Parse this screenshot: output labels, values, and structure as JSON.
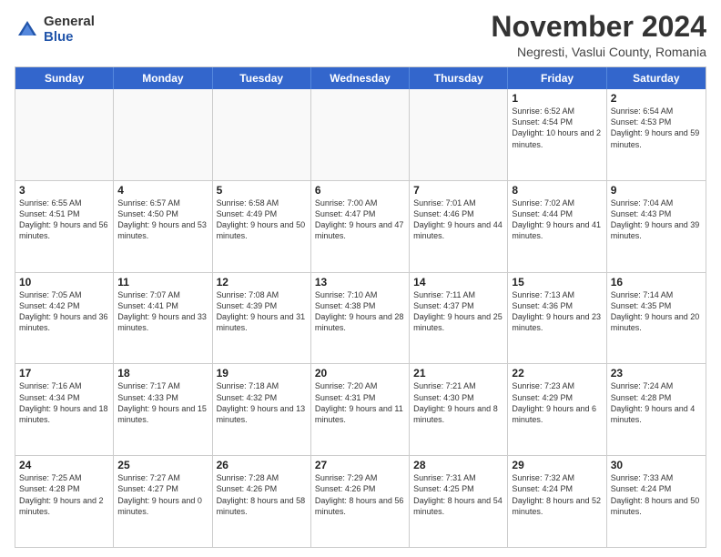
{
  "logo": {
    "general": "General",
    "blue": "Blue"
  },
  "title": "November 2024",
  "location": "Negresti, Vaslui County, Romania",
  "days": [
    "Sunday",
    "Monday",
    "Tuesday",
    "Wednesday",
    "Thursday",
    "Friday",
    "Saturday"
  ],
  "rows": [
    [
      {
        "day": "",
        "text": "",
        "empty": true
      },
      {
        "day": "",
        "text": "",
        "empty": true
      },
      {
        "day": "",
        "text": "",
        "empty": true
      },
      {
        "day": "",
        "text": "",
        "empty": true
      },
      {
        "day": "",
        "text": "",
        "empty": true
      },
      {
        "day": "1",
        "text": "Sunrise: 6:52 AM\nSunset: 4:54 PM\nDaylight: 10 hours\nand 2 minutes."
      },
      {
        "day": "2",
        "text": "Sunrise: 6:54 AM\nSunset: 4:53 PM\nDaylight: 9 hours\nand 59 minutes."
      }
    ],
    [
      {
        "day": "3",
        "text": "Sunrise: 6:55 AM\nSunset: 4:51 PM\nDaylight: 9 hours\nand 56 minutes."
      },
      {
        "day": "4",
        "text": "Sunrise: 6:57 AM\nSunset: 4:50 PM\nDaylight: 9 hours\nand 53 minutes."
      },
      {
        "day": "5",
        "text": "Sunrise: 6:58 AM\nSunset: 4:49 PM\nDaylight: 9 hours\nand 50 minutes."
      },
      {
        "day": "6",
        "text": "Sunrise: 7:00 AM\nSunset: 4:47 PM\nDaylight: 9 hours\nand 47 minutes."
      },
      {
        "day": "7",
        "text": "Sunrise: 7:01 AM\nSunset: 4:46 PM\nDaylight: 9 hours\nand 44 minutes."
      },
      {
        "day": "8",
        "text": "Sunrise: 7:02 AM\nSunset: 4:44 PM\nDaylight: 9 hours\nand 41 minutes."
      },
      {
        "day": "9",
        "text": "Sunrise: 7:04 AM\nSunset: 4:43 PM\nDaylight: 9 hours\nand 39 minutes."
      }
    ],
    [
      {
        "day": "10",
        "text": "Sunrise: 7:05 AM\nSunset: 4:42 PM\nDaylight: 9 hours\nand 36 minutes."
      },
      {
        "day": "11",
        "text": "Sunrise: 7:07 AM\nSunset: 4:41 PM\nDaylight: 9 hours\nand 33 minutes."
      },
      {
        "day": "12",
        "text": "Sunrise: 7:08 AM\nSunset: 4:39 PM\nDaylight: 9 hours\nand 31 minutes."
      },
      {
        "day": "13",
        "text": "Sunrise: 7:10 AM\nSunset: 4:38 PM\nDaylight: 9 hours\nand 28 minutes."
      },
      {
        "day": "14",
        "text": "Sunrise: 7:11 AM\nSunset: 4:37 PM\nDaylight: 9 hours\nand 25 minutes."
      },
      {
        "day": "15",
        "text": "Sunrise: 7:13 AM\nSunset: 4:36 PM\nDaylight: 9 hours\nand 23 minutes."
      },
      {
        "day": "16",
        "text": "Sunrise: 7:14 AM\nSunset: 4:35 PM\nDaylight: 9 hours\nand 20 minutes."
      }
    ],
    [
      {
        "day": "17",
        "text": "Sunrise: 7:16 AM\nSunset: 4:34 PM\nDaylight: 9 hours\nand 18 minutes."
      },
      {
        "day": "18",
        "text": "Sunrise: 7:17 AM\nSunset: 4:33 PM\nDaylight: 9 hours\nand 15 minutes."
      },
      {
        "day": "19",
        "text": "Sunrise: 7:18 AM\nSunset: 4:32 PM\nDaylight: 9 hours\nand 13 minutes."
      },
      {
        "day": "20",
        "text": "Sunrise: 7:20 AM\nSunset: 4:31 PM\nDaylight: 9 hours\nand 11 minutes."
      },
      {
        "day": "21",
        "text": "Sunrise: 7:21 AM\nSunset: 4:30 PM\nDaylight: 9 hours\nand 8 minutes."
      },
      {
        "day": "22",
        "text": "Sunrise: 7:23 AM\nSunset: 4:29 PM\nDaylight: 9 hours\nand 6 minutes."
      },
      {
        "day": "23",
        "text": "Sunrise: 7:24 AM\nSunset: 4:28 PM\nDaylight: 9 hours\nand 4 minutes."
      }
    ],
    [
      {
        "day": "24",
        "text": "Sunrise: 7:25 AM\nSunset: 4:28 PM\nDaylight: 9 hours\nand 2 minutes."
      },
      {
        "day": "25",
        "text": "Sunrise: 7:27 AM\nSunset: 4:27 PM\nDaylight: 9 hours\nand 0 minutes."
      },
      {
        "day": "26",
        "text": "Sunrise: 7:28 AM\nSunset: 4:26 PM\nDaylight: 8 hours\nand 58 minutes."
      },
      {
        "day": "27",
        "text": "Sunrise: 7:29 AM\nSunset: 4:26 PM\nDaylight: 8 hours\nand 56 minutes."
      },
      {
        "day": "28",
        "text": "Sunrise: 7:31 AM\nSunset: 4:25 PM\nDaylight: 8 hours\nand 54 minutes."
      },
      {
        "day": "29",
        "text": "Sunrise: 7:32 AM\nSunset: 4:24 PM\nDaylight: 8 hours\nand 52 minutes."
      },
      {
        "day": "30",
        "text": "Sunrise: 7:33 AM\nSunset: 4:24 PM\nDaylight: 8 hours\nand 50 minutes."
      }
    ]
  ]
}
